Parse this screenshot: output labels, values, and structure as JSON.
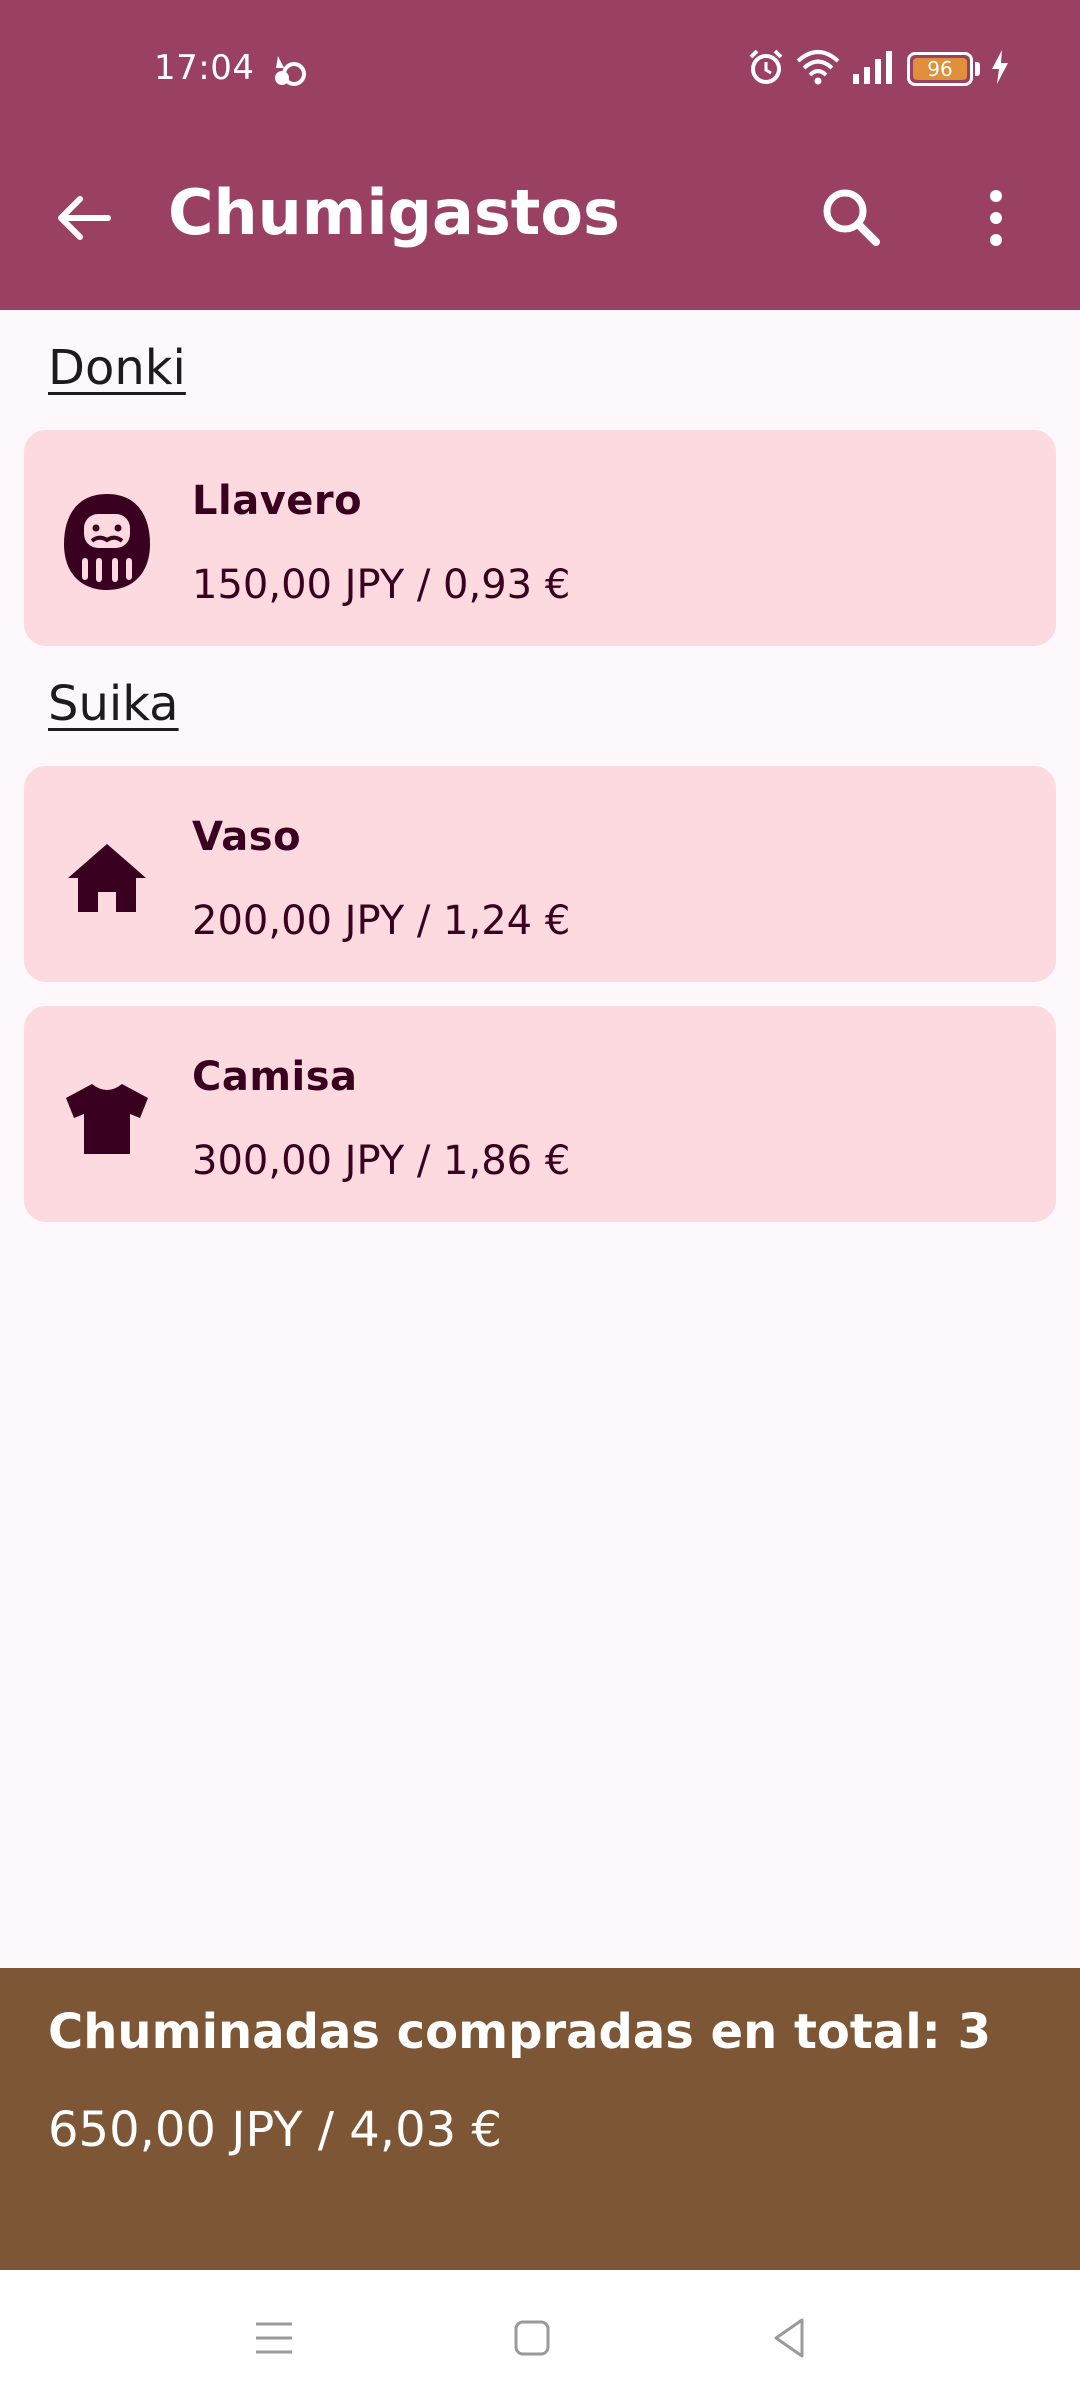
{
  "status_bar": {
    "time": "17:04",
    "battery": "96",
    "icons": [
      "weather-icon",
      "alarm-icon",
      "wifi-icon",
      "signal-icon",
      "battery-icon",
      "charging-icon"
    ]
  },
  "app_bar": {
    "title": "Chumigastos",
    "icons": [
      "back-arrow-icon",
      "search-icon",
      "more-vert-icon"
    ]
  },
  "sections": [
    {
      "title": "Donki",
      "items": [
        {
          "name": "Llavero",
          "price": "150,00 JPY / 0,93 €",
          "icon": "daruma-icon"
        }
      ]
    },
    {
      "title": "Suika",
      "items": [
        {
          "name": "Vaso",
          "price": "200,00 JPY / 1,24 €",
          "icon": "house-icon"
        },
        {
          "name": "Camisa",
          "price": "300,00 JPY / 1,86 €",
          "icon": "shirt-icon"
        }
      ]
    }
  ],
  "summary": {
    "title": "Chuminadas compradas en total: 3",
    "total": "650,00 JPY / 4,03 €"
  },
  "nav_bar": {
    "icons": [
      "menu-icon",
      "home-square-icon",
      "back-triangle-icon"
    ]
  },
  "colors": {
    "app_bar": "#994063",
    "card": "#fdd9e0",
    "card_text": "#3a0020",
    "summary_bar": "#7d5636",
    "background": "#fdf8fc"
  }
}
